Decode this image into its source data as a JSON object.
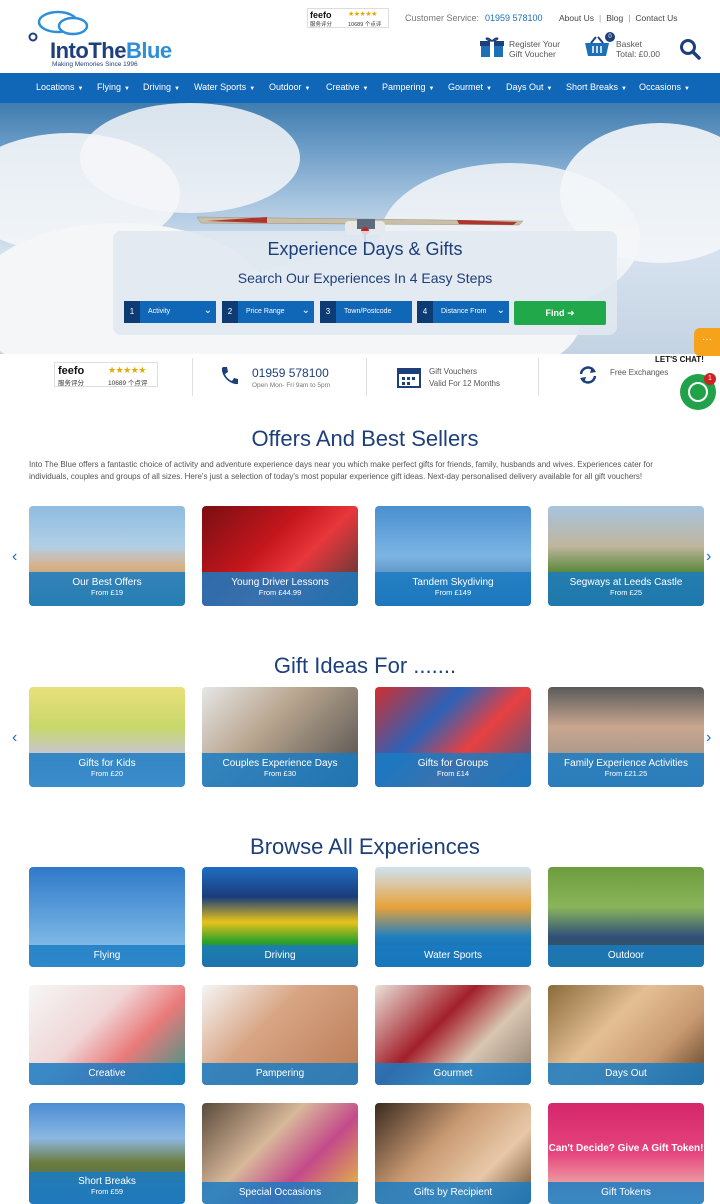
{
  "header": {
    "logo": "IntoTheBlue",
    "logo_into": "IntoThe",
    "logo_blue": "Blue",
    "tagline": "Making Memories Since 1996",
    "feefo_word": "feefo",
    "feefo_sub": "服务评分",
    "feefo_stars": "★★★★★",
    "feefo_count": "10689 个点评",
    "customer_label": "Customer Service:",
    "customer_phone": "01959 578100",
    "links": [
      "About Us",
      "Blog",
      "Contact Us"
    ],
    "voucher_l1": "Register Your",
    "voucher_l2": "Gift Voucher",
    "basket_l1": "Basket",
    "basket_l2": "Total: £0.00",
    "basket_count": "0"
  },
  "nav": [
    "Locations",
    "Flying",
    "Driving",
    "Water Sports",
    "Outdoor",
    "Creative",
    "Pampering",
    "Gourmet",
    "Days Out",
    "Short Breaks",
    "Occasions"
  ],
  "hero": {
    "title": "Experience Days & Gifts",
    "subtitle": "Search Our Experiences In 4 Easy Steps",
    "steps": [
      {
        "num": "1",
        "label": "Activity"
      },
      {
        "num": "2",
        "label": "Price Range"
      },
      {
        "num": "3",
        "label": "Town/Postcode"
      },
      {
        "num": "4",
        "label": "Distance From"
      }
    ],
    "find": "Find"
  },
  "trust": {
    "feefo_word": "feefo",
    "feefo_sub": "服务评分",
    "feefo_stars": "★★★★★",
    "feefo_count": "10689 个点评",
    "phone": "01959 578100",
    "hours": "Open Mon- Fri 9am to 5pm",
    "voucher_l1": "Gift Vouchers",
    "voucher_l2": "Valid For 12 Months",
    "exchange": "Free Exchanges"
  },
  "chat": {
    "label": "LET'S CHAT!",
    "badge": "1",
    "dots": "···"
  },
  "offers": {
    "title": "Offers And Best Sellers",
    "intro": "Into The Blue offers a fantastic choice of activity and adventure experience days near you which make perfect gifts for friends, family, husbands and wives. Experiences cater for individuals, couples and groups of all sizes. Here's just a selection of today's most popular experience gift ideas. Next-day personalised delivery available for all gift vouchers!",
    "cards": [
      {
        "title": "Our Best Offers",
        "price": "From £19"
      },
      {
        "title": "Young Driver Lessons",
        "price": "From £44.99"
      },
      {
        "title": "Tandem Skydiving",
        "price": "From £149"
      },
      {
        "title": "Segways at Leeds Castle",
        "price": "From £25"
      }
    ]
  },
  "gifts": {
    "title": "Gift Ideas For .......",
    "cards": [
      {
        "title": "Gifts for Kids",
        "price": "From £20"
      },
      {
        "title": "Couples Experience Days",
        "price": "From £30"
      },
      {
        "title": "Gifts for Groups",
        "price": "From £14"
      },
      {
        "title": "Family Experience Activities",
        "price": "From £21.25"
      }
    ]
  },
  "browse": {
    "title": "Browse All Experiences",
    "cards": [
      {
        "title": "Flying"
      },
      {
        "title": "Driving"
      },
      {
        "title": "Water Sports"
      },
      {
        "title": "Outdoor"
      },
      {
        "title": "Creative"
      },
      {
        "title": "Pampering"
      },
      {
        "title": "Gourmet"
      },
      {
        "title": "Days Out"
      },
      {
        "title": "Short Breaks",
        "price": "From £59"
      },
      {
        "title": "Special Occasions"
      },
      {
        "title": "Gifts by Recipient"
      },
      {
        "title": "Gift Tokens",
        "overlay": "Can't Decide? Give A Gift Token!"
      }
    ]
  },
  "colors": {
    "primary": "#1d3f7a",
    "nav": "#1167b7",
    "caption": "#1a7bc3",
    "find": "#20a84a",
    "chat": "#1fa24a"
  }
}
